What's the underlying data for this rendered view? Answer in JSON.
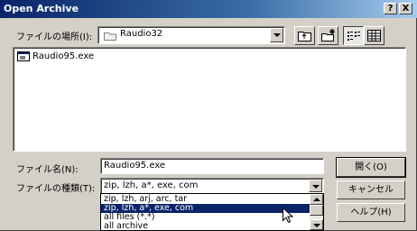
{
  "window": {
    "title": "Open Archive",
    "help_button": "?",
    "close_button": "X"
  },
  "look_in": {
    "label": "ファイルの場所(I):",
    "value": "Raudio32"
  },
  "file_list": {
    "items": [
      {
        "name": "Raudio95.exe",
        "icon": "exe-icon"
      }
    ]
  },
  "filename": {
    "label": "ファイル名(N):",
    "value": "Raudio95.exe"
  },
  "filetype": {
    "label": "ファイルの種類(T):",
    "value": "zip, lzh, a*, exe, com",
    "options": [
      "zip, lzh, arj, arc, tar",
      "zip, lzh, a*, exe, com",
      "all files (*.*)",
      "all archive"
    ],
    "selected_index": 1
  },
  "buttons": {
    "open": "開く(O)",
    "cancel": "キャンセル",
    "help": "ヘルプ(H)"
  },
  "colors": {
    "titlebar": "#0a246a",
    "selection": "#0a246a",
    "face": "#d4d0c8"
  }
}
